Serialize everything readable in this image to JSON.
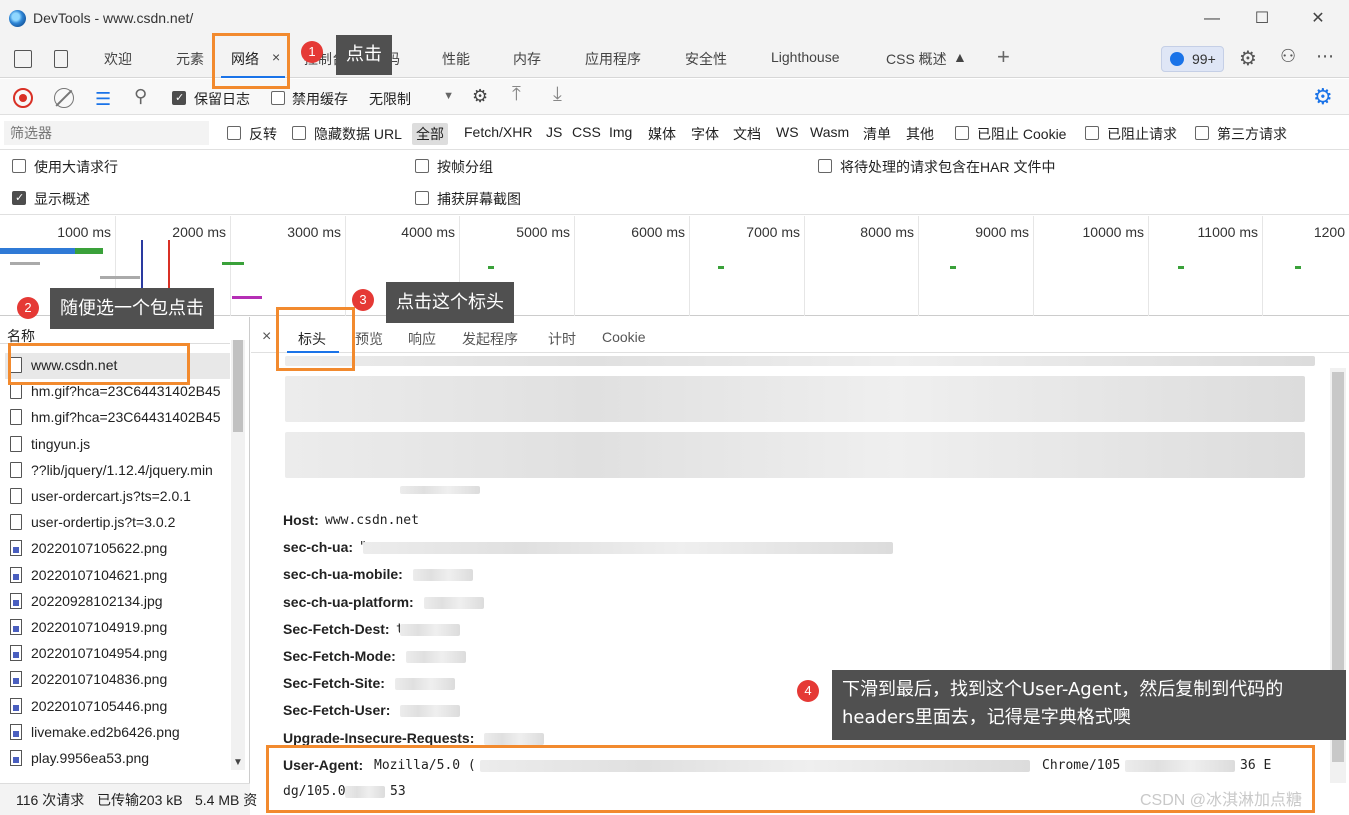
{
  "window": {
    "title": "DevTools - www.csdn.net/"
  },
  "tabs": [
    "欢迎",
    "元素",
    "网络",
    "控制台",
    "源代码",
    "性能",
    "内存",
    "应用程序",
    "安全性",
    "Lighthouse",
    "CSS 概述"
  ],
  "tab_close": "×",
  "tab_add": "+",
  "badge": "99+",
  "toolbar": {
    "preserve_log": "保留日志",
    "disable_cache": "禁用缓存",
    "throttle": "无限制"
  },
  "filter": {
    "placeholder": "筛选器",
    "invert": "反转",
    "hide_data_url": "隐藏数据 URL",
    "types": [
      "全部",
      "Fetch/XHR",
      "JS",
      "CSS",
      "Img",
      "媒体",
      "字体",
      "文档",
      "WS",
      "Wasm",
      "清单",
      "其他"
    ],
    "blocked_cookie": "已阻止 Cookie",
    "blocked_requests": "已阻止请求",
    "third_party": "第三方请求"
  },
  "settings": {
    "big_rows": "使用大请求行",
    "group_by_frame": "按帧分组",
    "har_pending": "将待处理的请求包含在HAR 文件中",
    "show_overview": "显示概述",
    "screenshots": "捕获屏幕截图"
  },
  "timeline": {
    "ticks": [
      "1000 ms",
      "2000 ms",
      "3000 ms",
      "4000 ms",
      "5000 ms",
      "6000 ms",
      "7000 ms",
      "8000 ms",
      "9000 ms",
      "10000 ms",
      "11000 ms",
      "1200"
    ]
  },
  "requests": {
    "header": "名称",
    "items": [
      {
        "name": "www.csdn.net",
        "icon": "file-icon"
      },
      {
        "name": "hm.gif?hca=23C64431402B45",
        "icon": "file-icon"
      },
      {
        "name": "hm.gif?hca=23C64431402B45",
        "icon": "file-icon"
      },
      {
        "name": "tingyun.js",
        "icon": "file-icon"
      },
      {
        "name": "??lib/jquery/1.12.4/jquery.min",
        "icon": "file-icon"
      },
      {
        "name": "user-ordercart.js?ts=2.0.1",
        "icon": "file-icon"
      },
      {
        "name": "user-ordertip.js?t=3.0.2",
        "icon": "file-icon"
      },
      {
        "name": "20220107105622.png",
        "icon": "image-icon"
      },
      {
        "name": "20220107104621.png",
        "icon": "image-icon"
      },
      {
        "name": "20220928102134.jpg",
        "icon": "image-icon"
      },
      {
        "name": "20220107104919.png",
        "icon": "image-icon"
      },
      {
        "name": "20220107104954.png",
        "icon": "image-icon"
      },
      {
        "name": "20220107104836.png",
        "icon": "image-icon"
      },
      {
        "name": "20220107105446.png",
        "icon": "image-icon"
      },
      {
        "name": "livemake.ed2b6426.png",
        "icon": "image-icon"
      },
      {
        "name": "play.9956ea53.png",
        "icon": "image-icon"
      }
    ]
  },
  "status": {
    "requests": "116 次请求",
    "transferred": "已传输203 kB",
    "resources": "5.4 MB 资"
  },
  "detail": {
    "close": "×",
    "tabs": [
      "标头",
      "预览",
      "响应",
      "发起程序",
      "计时",
      "Cookie"
    ],
    "headers": [
      {
        "name": "Host:",
        "value": "www.csdn.net"
      },
      {
        "name": "sec-ch-ua:",
        "value": "\""
      },
      {
        "name": "sec-ch-ua-mobile:",
        "value": ""
      },
      {
        "name": "sec-ch-ua-platform:",
        "value": ""
      },
      {
        "name": "Sec-Fetch-Dest:",
        "value": "t"
      },
      {
        "name": "Sec-Fetch-Mode:",
        "value": ""
      },
      {
        "name": "Sec-Fetch-Site:",
        "value": ""
      },
      {
        "name": "Sec-Fetch-User:",
        "value": ""
      },
      {
        "name": "Upgrade-Insecure-Requests:",
        "value": ""
      }
    ],
    "user_agent": {
      "name": "User-Agent:",
      "value_line1_start": "Mozilla/5.0 (",
      "value_line1_mid": "Chrome/105",
      "value_line1_end": "36 E",
      "value_line2_start": "dg/105.0",
      "value_line2_end": "53"
    }
  },
  "annotations": {
    "n1": "1",
    "t1": "点击",
    "n2": "2",
    "t2": "随便选一个包点击",
    "n3": "3",
    "t3": "点击这个标头",
    "n4": "4",
    "t4a": "下滑到最后，找到这个User-Agent，然后复制到代码的",
    "t4b": "headers里面去，记得是字典格式噢"
  },
  "watermark": "CSDN @冰淇淋加点糖",
  "colors": {
    "accent": "#1a73e8",
    "annotation_border": "#f28a2e",
    "annotation_number": "#e53935",
    "tooltip_bg": "#505050"
  }
}
